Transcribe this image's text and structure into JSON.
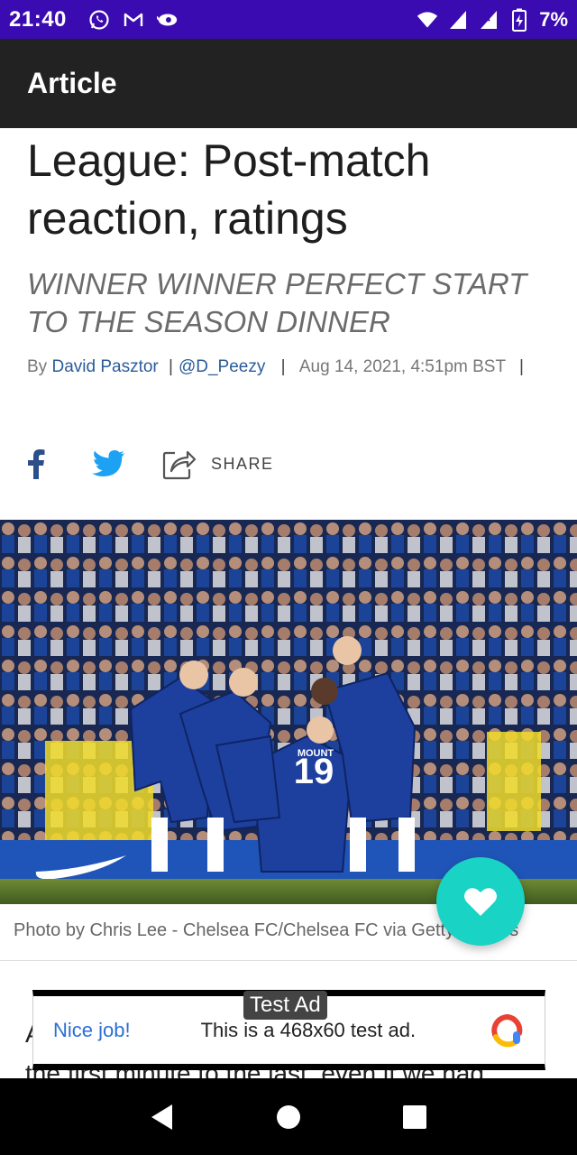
{
  "status_bar": {
    "time": "21:40",
    "battery": "7%",
    "icons_left": [
      "whatsapp-icon",
      "gmail-icon",
      "sync-icon"
    ],
    "icons_right": [
      "wifi-icon",
      "signal-icon",
      "signal-no-data-icon",
      "battery-charging-icon"
    ]
  },
  "app_bar": {
    "title": "Article"
  },
  "article": {
    "headline": "League: Post-match reaction, ratings",
    "subhead": "WINNER WINNER PERFECT START TO THE SEASON DINNER",
    "byline": {
      "prefix": "By",
      "author": "David Pasztor",
      "separator": "|",
      "handle": "@D_Peezy",
      "date": "Aug 14, 2021, 4:51pm BST"
    },
    "share": {
      "label": "SHARE"
    },
    "photo": {
      "caption": "Photo by Chris Lee - Chelsea FC/Chelsea FC via Getty Images",
      "shirt_number": "19",
      "shirt_name": "MOUNT"
    },
    "body_start": "A",
    "body_line2": "the first minute to the last, even if we had"
  },
  "ad": {
    "badge": "Test Ad",
    "nice": "Nice job!",
    "text": "This is a 468x60 test ad."
  },
  "colors": {
    "status_bar": "#3a0bb0",
    "app_bar": "#222222",
    "fab": "#19d3c5",
    "link": "#2a5c99",
    "facebook": "#2a4f8a",
    "twitter": "#1da1f2"
  }
}
